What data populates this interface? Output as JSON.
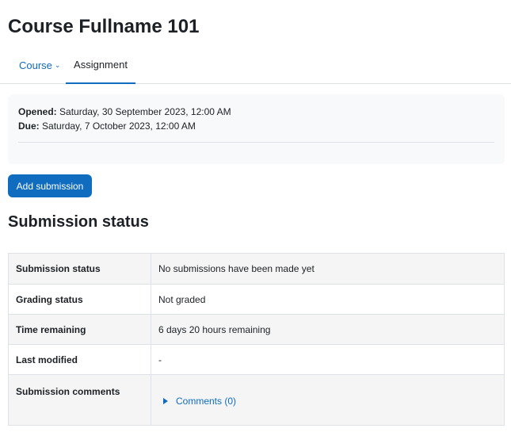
{
  "page": {
    "title": "Course Fullname 101"
  },
  "tabs": [
    {
      "label": "Course",
      "has_dropdown": true,
      "active": false
    },
    {
      "label": "Assignment",
      "active": true
    }
  ],
  "dates": {
    "opened_label": "Opened:",
    "opened_value": "Saturday, 30 September 2023, 12:00 AM",
    "due_label": "Due:",
    "due_value": "Saturday, 7 October 2023, 12:00 AM"
  },
  "actions": {
    "add_submission": "Add submission"
  },
  "submission": {
    "heading": "Submission status",
    "rows": [
      {
        "key": "Submission status",
        "value": "No submissions have been made yet"
      },
      {
        "key": "Grading status",
        "value": "Not graded"
      },
      {
        "key": "Time remaining",
        "value": "6 days 20 hours remaining"
      },
      {
        "key": "Last modified",
        "value": "-"
      },
      {
        "key": "Submission comments",
        "value": "Comments (0)"
      }
    ]
  },
  "colors": {
    "accent": "#0f6cbf",
    "text": "#1d2125",
    "border": "#dee2e6",
    "panel_bg": "#f8f9fa"
  },
  "icons": {
    "tab_dropdown": "chevron-down-icon",
    "comments_toggle": "caret-right-icon"
  }
}
